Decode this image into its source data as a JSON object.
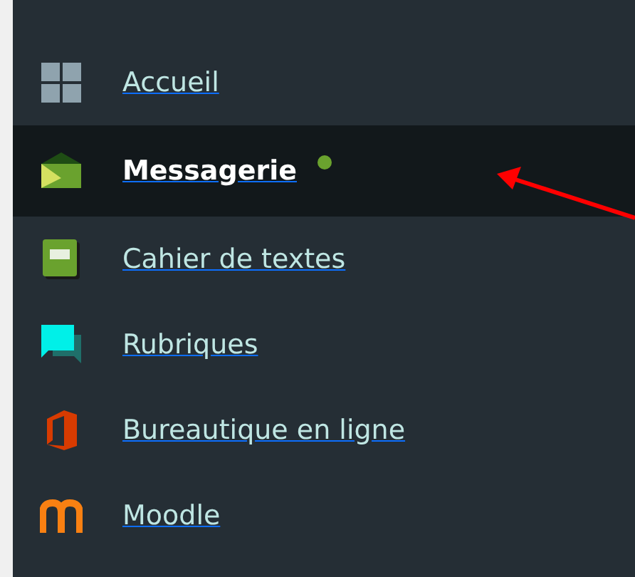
{
  "menu": {
    "items": [
      {
        "label": "Accueil",
        "kind": "grid",
        "selected": false,
        "unread": false
      },
      {
        "label": "Messagerie",
        "kind": "envelope",
        "selected": true,
        "unread": true
      },
      {
        "label": "Cahier de textes",
        "kind": "notebook",
        "selected": false,
        "unread": false
      },
      {
        "label": "Rubriques",
        "kind": "chat",
        "selected": false,
        "unread": false
      },
      {
        "label": "Bureautique en ligne",
        "kind": "office",
        "selected": false,
        "unread": false
      },
      {
        "label": "Moodle",
        "kind": "moodle",
        "selected": false,
        "unread": false
      }
    ]
  },
  "annotations": [
    {
      "kind": "arrow"
    }
  ]
}
